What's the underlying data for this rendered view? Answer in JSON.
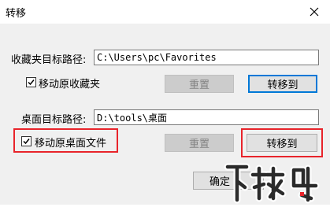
{
  "window": {
    "title": "转移",
    "close_icon": "close-icon"
  },
  "favorites": {
    "label": "收藏夹目标路径:",
    "path_value": "C:\\Users\\pc\\Favorites",
    "checkbox_label": "移动原收藏夹",
    "checked": true,
    "reset_label": "重置",
    "move_label": "转移到"
  },
  "desktop": {
    "label": "桌面目标路径:",
    "path_value": "D:\\tools\\桌面",
    "checkbox_label": "移动原桌面文件",
    "checked": true,
    "reset_label": "重置",
    "move_label": "转移到"
  },
  "footer": {
    "ok_label": "确定"
  },
  "watermark": {
    "text": "下载吧"
  },
  "colors": {
    "highlight": "#e8242b",
    "focus_border": "#0078d7"
  }
}
